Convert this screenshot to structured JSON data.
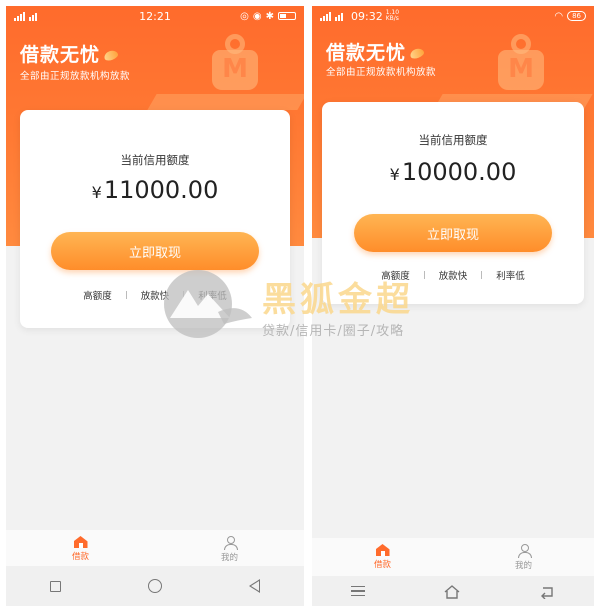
{
  "left_screen": {
    "status": {
      "carrier": "☺",
      "time": "12:21"
    },
    "brand": {
      "title": "借款无忧",
      "subtitle": "全部由正规放款机构放款"
    },
    "card": {
      "label": "当前信用额度",
      "currency": "¥",
      "amount": "11000.00",
      "cta": "立即取现",
      "features": [
        "高额度",
        "放款快",
        "利率低"
      ]
    },
    "tabs": [
      {
        "label": "借款"
      },
      {
        "label": "我的"
      }
    ]
  },
  "right_screen": {
    "status": {
      "time": "09:32",
      "speed": "1.10\nKB/s",
      "battery": "86"
    },
    "brand": {
      "title": "借款无忧",
      "subtitle": "全部由正规放款机构放款"
    },
    "card": {
      "label": "当前信用额度",
      "currency": "¥",
      "amount": "10000.00",
      "cta": "立即取现",
      "features": [
        "高额度",
        "放款快",
        "利率低"
      ]
    },
    "tabs": [
      {
        "label": "借款"
      },
      {
        "label": "我的"
      }
    ]
  },
  "watermark": {
    "title": "黑狐金超",
    "subtitle": "贷款/信用卡/圈子/攻略"
  },
  "colors": {
    "accent": "#ff6b2c",
    "button": "#ff9a35",
    "watermark_gold": "#fad78c"
  }
}
